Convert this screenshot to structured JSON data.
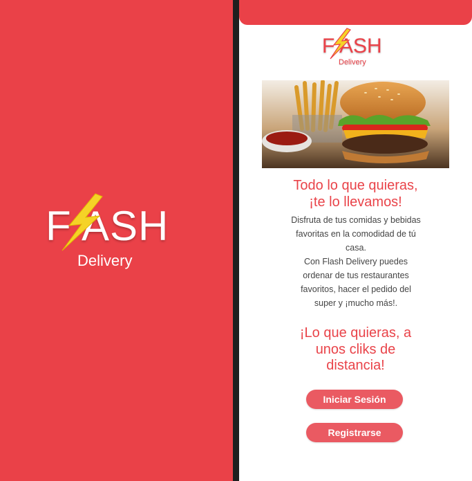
{
  "splash": {
    "logo_word": "FLASH",
    "logo_word_visible": "F ASH",
    "logo_sub": "Delivery"
  },
  "app": {
    "logo_word_visible": "F ASH",
    "logo_sub": "Delivery",
    "hero_image": "burger-and-fries",
    "headline_line1": "Todo lo que quieras,",
    "headline_line2": "¡te lo llevamos!",
    "body_lines": [
      "Disfruta de tus comidas y bebidas",
      "favoritas en la comodidad de tú",
      "casa.",
      "Con Flash Delivery puedes",
      "ordenar de tus restaurantes",
      "favoritos, hacer el pedido del",
      "super y ¡mucho más!."
    ],
    "tagline_lines": [
      "¡Lo que quieras, a",
      "unos cliks de",
      "distancia!"
    ],
    "login_label": "Iniciar Sesión",
    "register_label": "Registrarse"
  },
  "colors": {
    "brand_red": "#ea4148",
    "button_red": "#ea5a62",
    "bolt_yellow": "#f5d327"
  }
}
